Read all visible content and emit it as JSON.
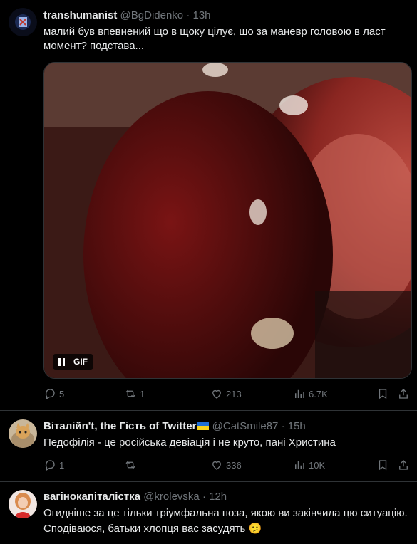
{
  "posts": [
    {
      "name": "transhumanist",
      "handle": "@BgDidenko",
      "time": "13h",
      "text": "малий був впевнений що в щоку цілує, шо за маневр головою в ласт момент? подстава...",
      "media": {
        "badge": "GIF"
      },
      "stats": {
        "replies": "5",
        "reposts": "1",
        "likes": "213",
        "views": "6.7K"
      }
    },
    {
      "name": "Віталійn't, the Гість of Twitter",
      "handle": "@CatSmile87",
      "time": "15h",
      "text": "Педофілія - це російська девіація і не круто, пані Христина",
      "stats": {
        "replies": "1",
        "reposts": "",
        "likes": "336",
        "views": "10K"
      }
    },
    {
      "name": "вагінокапіталістка",
      "handle": "@krolevska",
      "time": "12h",
      "text": "Огидніше за це тільки тріумфальна поза, якою ви закінчила цю ситуацію. Сподіваюся, батьки хлопця вас засудять 🫤"
    }
  ],
  "separator": "·",
  "colors": {
    "background": "#000000",
    "muted": "#71767b",
    "divider": "#2f3336",
    "text": "#e7e9ea"
  },
  "icons": [
    "reply-icon",
    "repost-icon",
    "like-icon",
    "views-icon",
    "bookmark-icon",
    "share-icon",
    "pause-icon",
    "ukraine-flag-icon"
  ]
}
